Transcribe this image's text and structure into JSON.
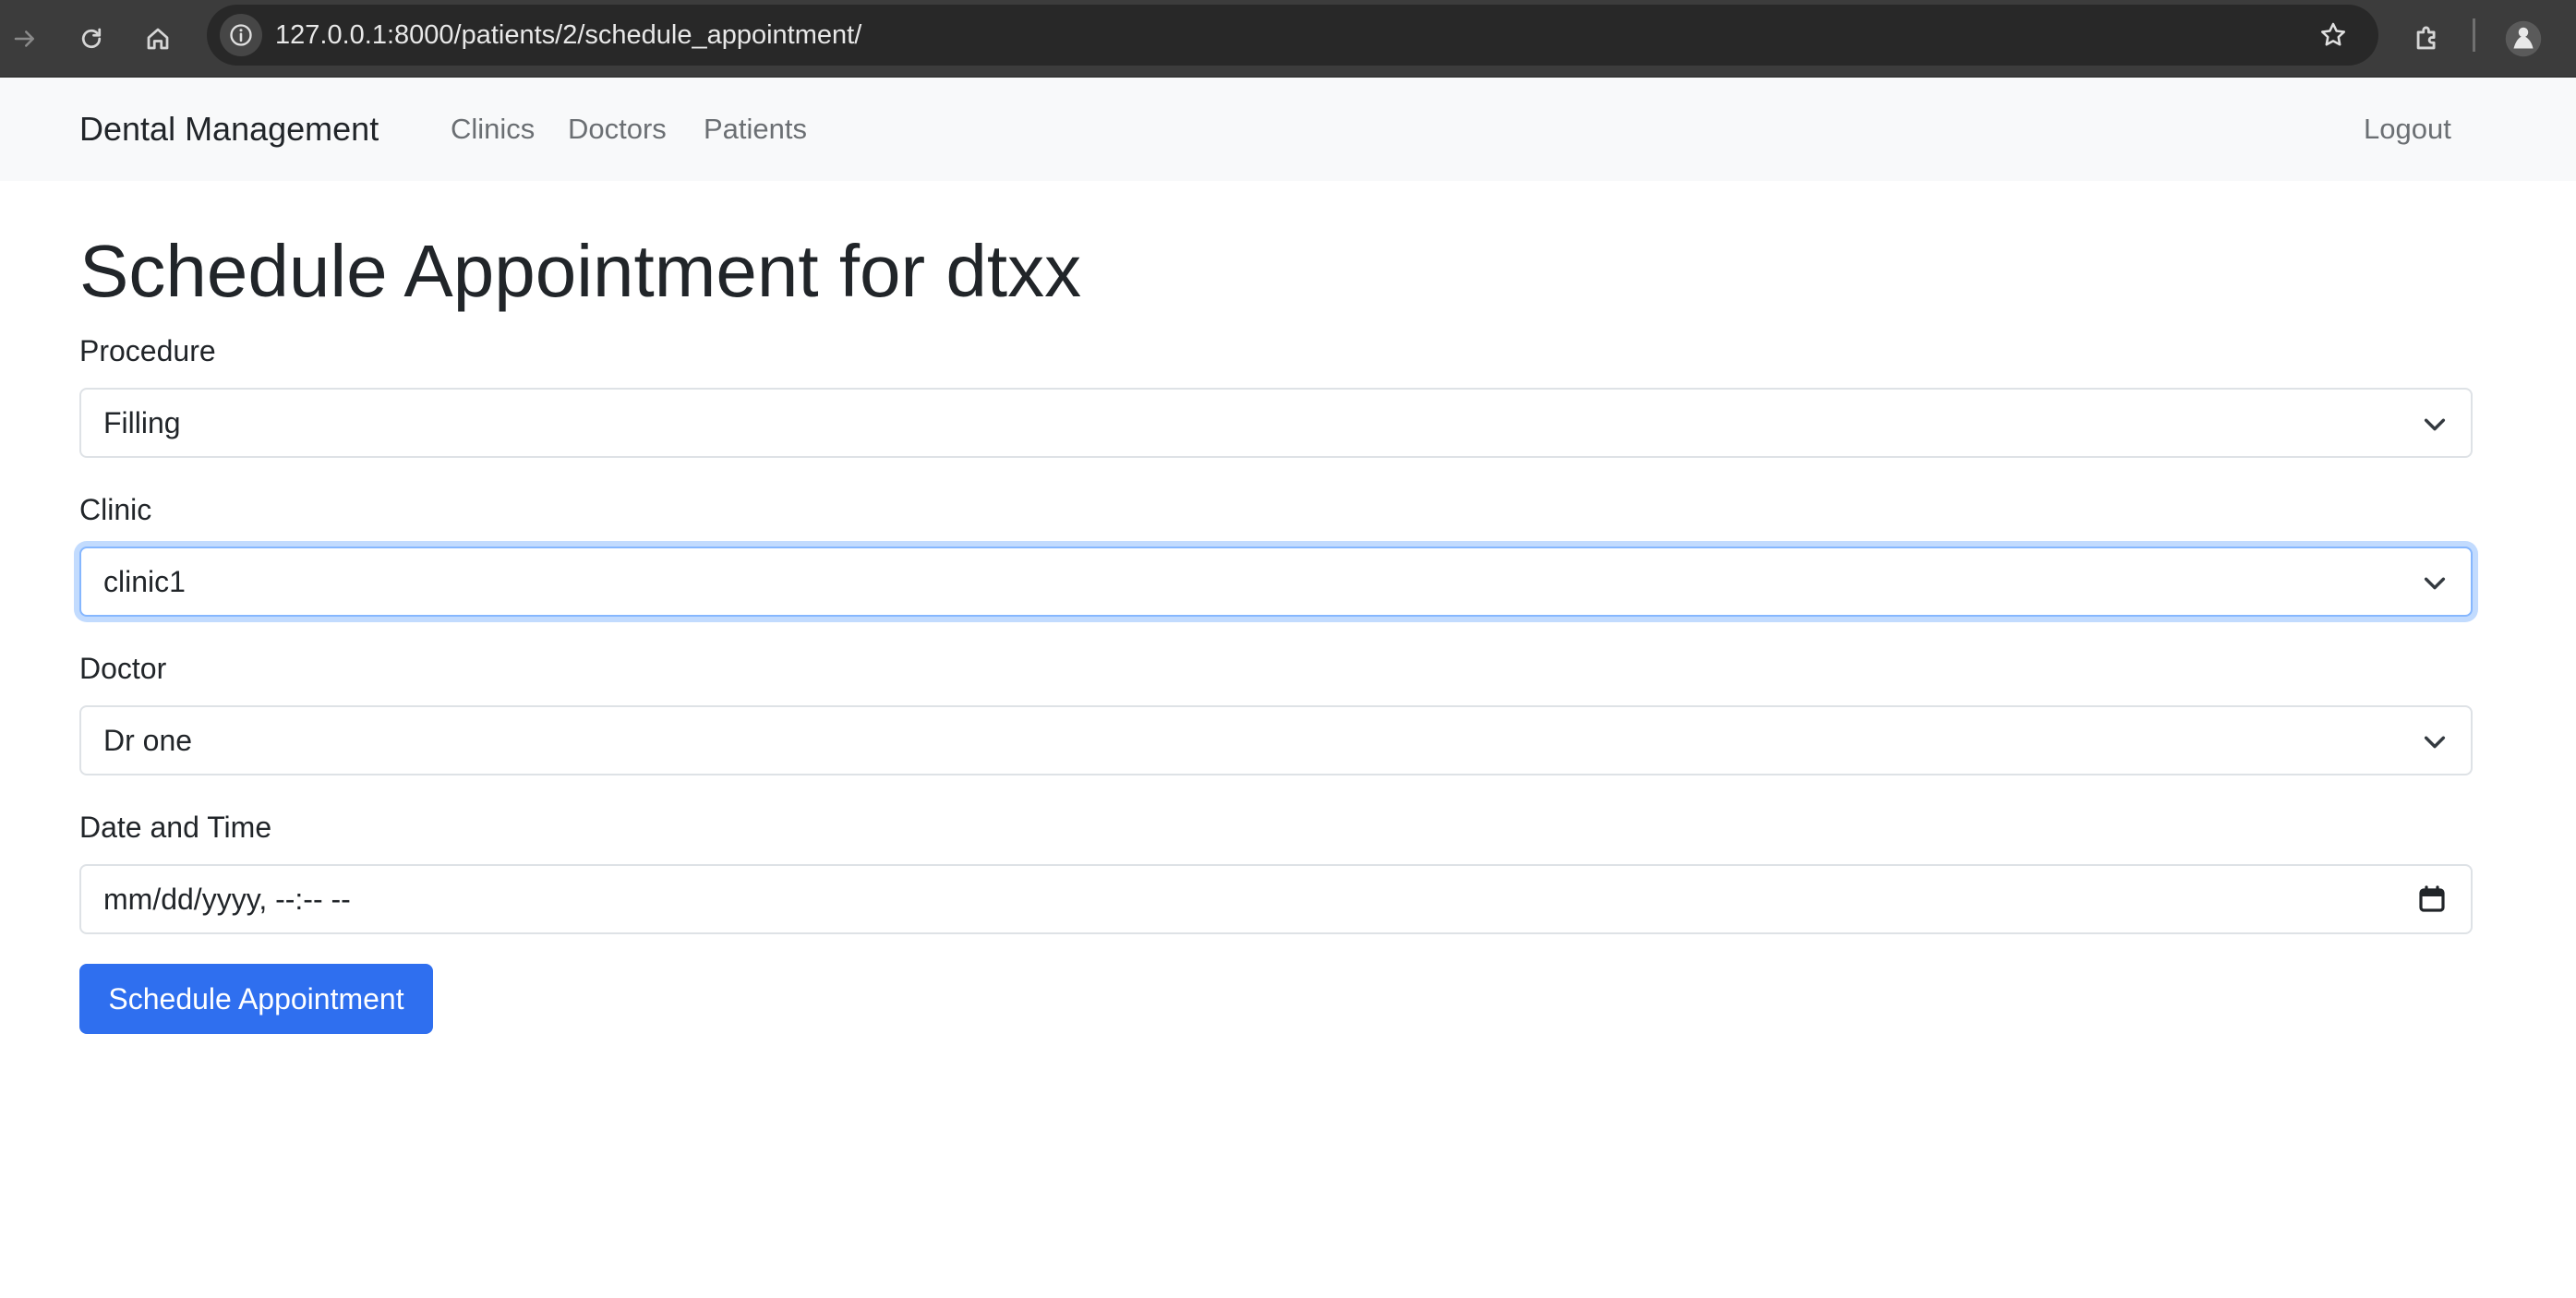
{
  "browser": {
    "url": "127.0.0.1:8000/patients/2/schedule_appointment/",
    "icons": [
      "forward-icon",
      "reload-icon",
      "home-icon",
      "site-info-icon",
      "bookmark-star-icon",
      "extensions-icon",
      "profile-avatar-icon"
    ]
  },
  "navbar": {
    "brand": "Dental Management",
    "links": [
      "Clinics",
      "Doctors",
      "Patients"
    ],
    "logout": "Logout"
  },
  "main": {
    "title": "Schedule Appointment for dtxx",
    "fields": {
      "procedure": {
        "label": "Procedure",
        "value": "Filling"
      },
      "clinic": {
        "label": "Clinic",
        "value": "clinic1"
      },
      "doctor": {
        "label": "Doctor",
        "value": "Dr one"
      },
      "datetime": {
        "label": "Date and Time",
        "placeholder": "mm/dd/yyyy, --:-- --"
      }
    },
    "submit_label": "Schedule Appointment"
  },
  "colors": {
    "primary": "#2f6fef",
    "navbar_bg": "#f8f9fa",
    "focus_ring": "#86b7fe",
    "browser_chrome": "#3c3c3c"
  }
}
